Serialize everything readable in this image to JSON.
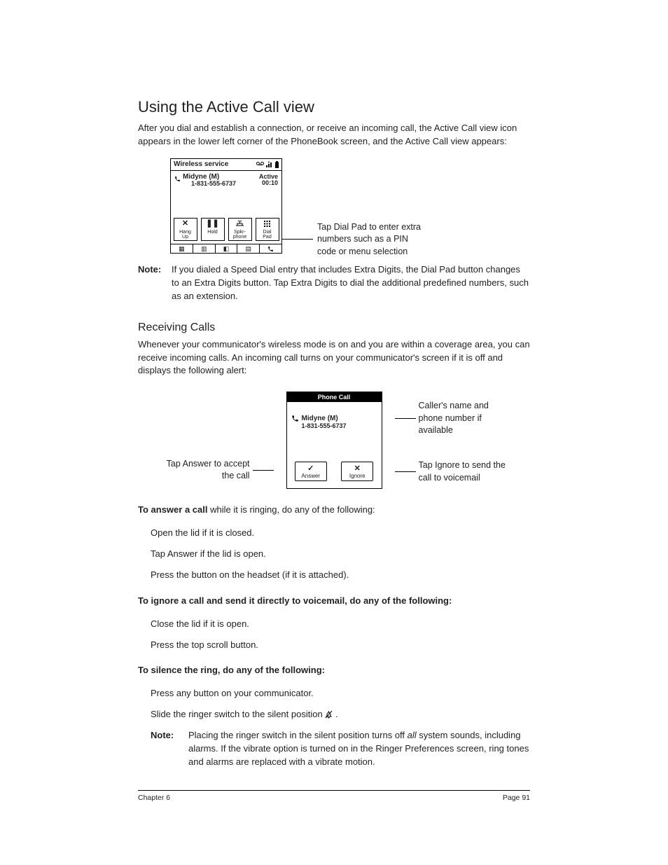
{
  "h1": "Using the Active Call view",
  "intro1": "After you dial and establish a connection, or receive an incoming call, the Active Call view icon appears in the lower left corner of the PhoneBook screen, and the Active Call view appears:",
  "fig1": {
    "service": "Wireless service",
    "caller": "Midyne (M)",
    "number": "1-831-555-6737",
    "status": "Active",
    "timer": "00:10",
    "btns": [
      {
        "icon": "✕",
        "label": "Hang\nUp"
      },
      {
        "icon": "❚❚",
        "label": "Hold"
      },
      {
        "icon": "spk",
        "label": "Spkr-\nphone"
      },
      {
        "icon": "⠿",
        "label": "Dial\nPad"
      }
    ],
    "callout": "Tap Dial Pad to enter extra numbers such as a PIN code or menu selection"
  },
  "note1_label": "Note:",
  "note1_body": "If you dialed a Speed Dial entry that includes Extra Digits, the Dial Pad button changes to an Extra Digits button. Tap Extra Digits to dial the additional predefined numbers, such as an extension.",
  "h2": "Receiving Calls",
  "recv_intro": "Whenever your communicator's wireless mode is on and you are within a coverage area, you can receive incoming calls. An incoming call turns on your communicator's screen if it is off and displays the following alert:",
  "fig2": {
    "title": "Phone Call",
    "caller": "Midyne (M)",
    "number": "1-831-555-6737",
    "answer": "Answer",
    "ignore": "Ignore",
    "callout_right1": "Caller's name and phone number if available",
    "callout_right2": "Tap Ignore to send the call to voicemail",
    "callout_left": "Tap Answer to accept the call"
  },
  "answer_lead_pre": "To answer ",
  "answer_lead_bold": "a call",
  "answer_lead_post": " while it is ringing, do any of the following:",
  "answer_steps": [
    "Open the lid if it is closed.",
    "Tap Answer if the lid is open.",
    "Press the button on the headset (if it is attached)."
  ],
  "ignore_lead": "To ignore a call and send it directly to voicemail, do any of the following:",
  "ignore_steps": [
    "Close the lid if it is open.",
    "Press the top scroll button."
  ],
  "silence_lead": "To silence the ring, do any of the following:",
  "silence_steps": [
    "Press any button on your communicator.",
    "Slide the ringer switch to the silent position "
  ],
  "silence_icon": "🔕",
  "silence_suffix": ".",
  "note2_label": "Note:",
  "note2_pre": "Placing the ringer switch in the silent position turns off ",
  "note2_italic": "all",
  "note2_post": " system sounds, including alarms. If the vibrate option is turned on in the Ringer Preferences screen, ring tones and alarms are replaced with a vibrate motion.",
  "footer_left": "Chapter 6",
  "footer_right": "Page 91"
}
